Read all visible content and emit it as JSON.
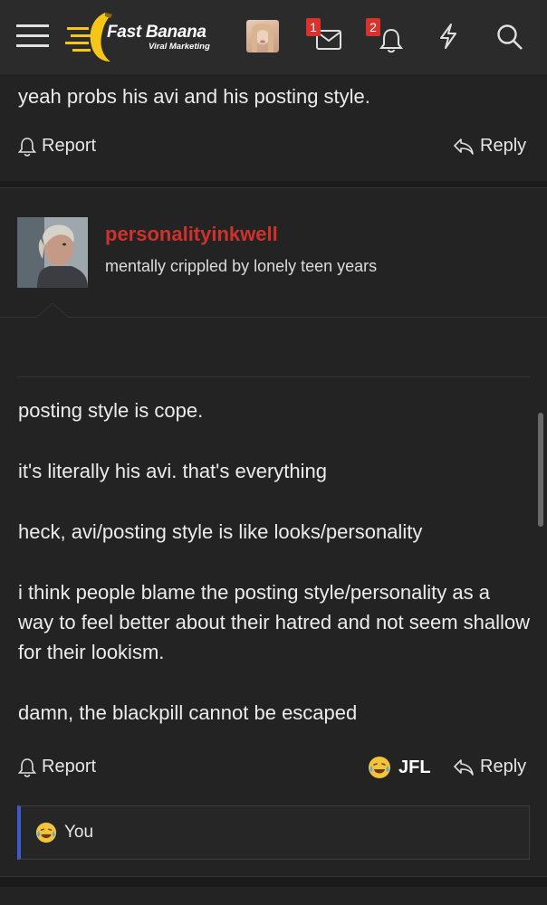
{
  "header": {
    "logo_title": "Fast Banana",
    "logo_subtitle": "Viral Marketing",
    "inbox_badge": "1",
    "alerts_badge": "2",
    "icons": [
      "menu-icon",
      "inbox-icon",
      "bell-icon",
      "bolt-icon",
      "search-icon"
    ]
  },
  "previous_post": {
    "text": "yeah probs his avi and his posting style.",
    "report_label": "Report",
    "reply_label": "Reply"
  },
  "post": {
    "username": "personalityinkwell",
    "user_title": "mentally crippled by lonely teen years",
    "paragraphs": [
      "posting style is cope.",
      "it's literally his avi. that's everything",
      "heck, avi/posting style is like looks/personality",
      "i think people blame the posting style/personality as a way to feel better about their hatred and not seem shallow for their lookism.",
      "damn, the blackpill cannot be escaped"
    ],
    "report_label": "Report",
    "reaction_label": "JFL",
    "reply_label": "Reply",
    "reactions_summary": "You"
  },
  "colors": {
    "username": "#d0312d",
    "badge": "#d9312b",
    "reaction_bar_accent": "#3b5bc9",
    "background": "#232323",
    "topbar": "#2b2b2b"
  }
}
